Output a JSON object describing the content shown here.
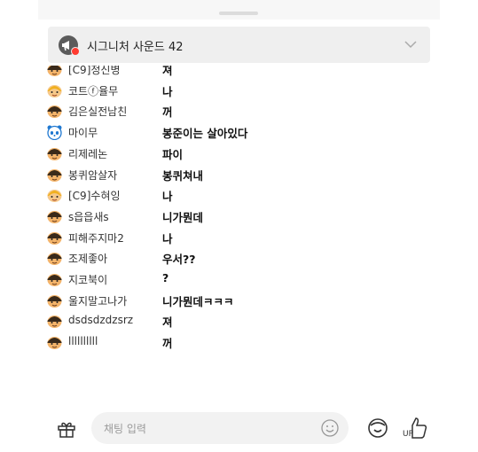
{
  "notice": {
    "title": "시그니처 사운드 42"
  },
  "messages": [
    {
      "nick": "[C9]정신병",
      "text": "져",
      "avatar": "face-icon"
    },
    {
      "nick": "코트ⓕ율무",
      "text": "나",
      "avatar": "blonde-face-icon"
    },
    {
      "nick": "김은실전남친",
      "text": "꺼",
      "avatar": "face-icon"
    },
    {
      "nick": "마이무",
      "text": "봉준이는 살아있다",
      "avatar": "panda-face-icon"
    },
    {
      "nick": "리제레논",
      "text": "파이",
      "avatar": "face-icon"
    },
    {
      "nick": "봉퀴암살자",
      "text": "봉퀴쳐내",
      "avatar": "face-icon"
    },
    {
      "nick": "[C9]수혀잉",
      "text": "나",
      "avatar": "blonde-face-icon"
    },
    {
      "nick": "s읍읍새s",
      "text": "니가뭔데",
      "avatar": "face-icon"
    },
    {
      "nick": "피해주지마2",
      "text": "나",
      "avatar": "face-icon"
    },
    {
      "nick": "조제좋아",
      "text": "우서??",
      "avatar": "face-icon"
    },
    {
      "nick": "지코북이",
      "text": "?",
      "avatar": "face-icon"
    },
    {
      "nick": "울지말고나가",
      "text": "니가뭔데ㅋㅋㅋ",
      "avatar": "face-icon"
    },
    {
      "nick": "dsdsdzdzsrz",
      "text": "져",
      "avatar": "face-icon"
    },
    {
      "nick": "llllllllll",
      "text": "꺼",
      "avatar": "face-icon"
    }
  ],
  "input": {
    "placeholder": "채팅 입력"
  },
  "up_label": "UP"
}
